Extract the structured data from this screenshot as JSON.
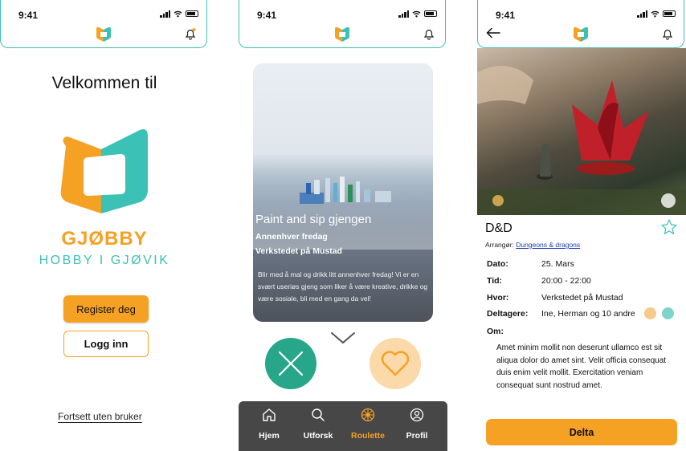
{
  "status": {
    "time": "9:41"
  },
  "colors": {
    "accent": "#f5a123",
    "teal": "#3cc1b7",
    "green": "#27a689"
  },
  "welcome": {
    "heading": "Velkommen til",
    "brand_name": "GJØBBY",
    "tagline": "HOBBY I GJØVIK",
    "register_label": "Register deg",
    "login_label": "Logg inn",
    "guest_link": "Fortsett uten bruker"
  },
  "roulette": {
    "card": {
      "title": "Paint and sip gjengen",
      "frequency": "Annenhver fredag",
      "location": "Verkstedet på Mustad",
      "description": "Blir med å mal og drikk litt annenhver fredag! Vi er en svært useriøs gjeng som liker å være kreative, drikke og være sosiale, bli med en gang da vel!"
    },
    "tabs": [
      {
        "label": "Hjem",
        "icon": "home-icon"
      },
      {
        "label": "Utforsk",
        "icon": "search-icon"
      },
      {
        "label": "Roulette",
        "icon": "roulette-icon",
        "active": true
      },
      {
        "label": "Profil",
        "icon": "profile-icon"
      }
    ]
  },
  "event": {
    "title": "D&D",
    "organizer_prefix": "Arrangør:",
    "organizer_link": "Dungeons & dragons",
    "rows": [
      {
        "label": "Dato:",
        "value": "25. Mars"
      },
      {
        "label": "Tid:",
        "value": "20:00 - 22:00"
      },
      {
        "label": "Hvor:",
        "value": "Verkstedet på Mustad"
      },
      {
        "label": "Deltagere:",
        "value": "Ine, Herman og 10 andre"
      }
    ],
    "about_label": "Om:",
    "about_text": "Amet minim mollit non deserunt ullamco est sit aliqua dolor do amet sint. Velit officia consequat duis enim velit mollit. Exercitation veniam consequat sunt nostrud amet.",
    "join_label": "Delta"
  }
}
